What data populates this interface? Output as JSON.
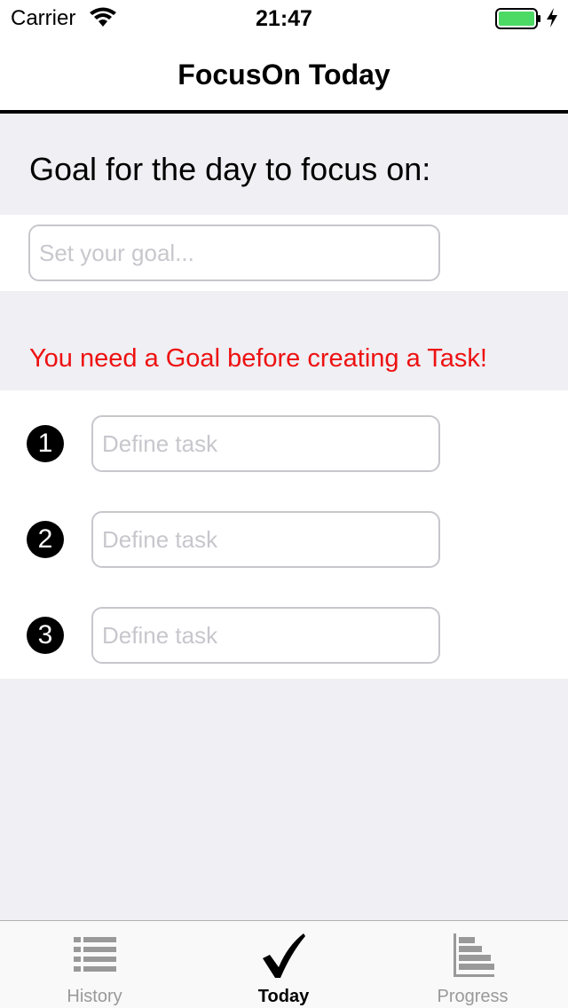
{
  "status_bar": {
    "carrier": "Carrier",
    "time": "21:47",
    "battery_color": "#4cd964"
  },
  "nav": {
    "title": "FocusOn Today"
  },
  "goal": {
    "heading": "Goal for the day to focus on:",
    "placeholder": "Set your goal...",
    "value": ""
  },
  "warning": {
    "text": "You need a Goal before creating a Task!",
    "color": "#ee1111"
  },
  "tasks": [
    {
      "number": "1",
      "placeholder": "Define task",
      "value": ""
    },
    {
      "number": "2",
      "placeholder": "Define task",
      "value": ""
    },
    {
      "number": "3",
      "placeholder": "Define task",
      "value": ""
    }
  ],
  "tab_bar": {
    "tabs": [
      {
        "label": "History",
        "icon": "list-icon",
        "active": false
      },
      {
        "label": "Today",
        "icon": "checkmark-icon",
        "active": true
      },
      {
        "label": "Progress",
        "icon": "bar-chart-icon",
        "active": false
      }
    ]
  }
}
